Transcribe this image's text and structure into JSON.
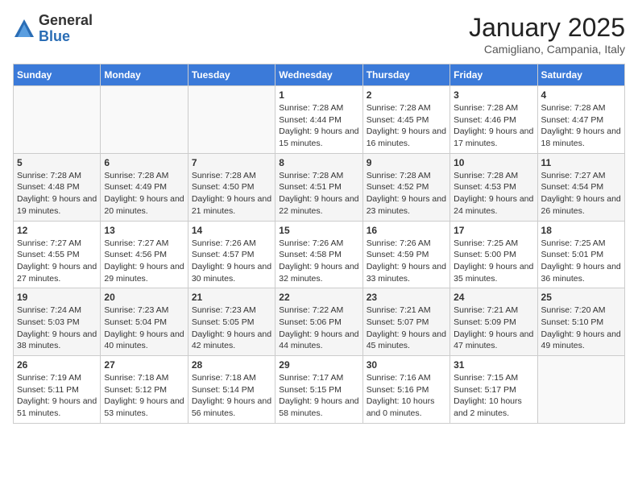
{
  "header": {
    "logo_general": "General",
    "logo_blue": "Blue",
    "month_title": "January 2025",
    "location": "Camigliano, Campania, Italy"
  },
  "days_of_week": [
    "Sunday",
    "Monday",
    "Tuesday",
    "Wednesday",
    "Thursday",
    "Friday",
    "Saturday"
  ],
  "weeks": [
    [
      {
        "day": "",
        "sunrise": "",
        "sunset": "",
        "daylight": ""
      },
      {
        "day": "",
        "sunrise": "",
        "sunset": "",
        "daylight": ""
      },
      {
        "day": "",
        "sunrise": "",
        "sunset": "",
        "daylight": ""
      },
      {
        "day": "1",
        "sunrise": "Sunrise: 7:28 AM",
        "sunset": "Sunset: 4:44 PM",
        "daylight": "Daylight: 9 hours and 15 minutes."
      },
      {
        "day": "2",
        "sunrise": "Sunrise: 7:28 AM",
        "sunset": "Sunset: 4:45 PM",
        "daylight": "Daylight: 9 hours and 16 minutes."
      },
      {
        "day": "3",
        "sunrise": "Sunrise: 7:28 AM",
        "sunset": "Sunset: 4:46 PM",
        "daylight": "Daylight: 9 hours and 17 minutes."
      },
      {
        "day": "4",
        "sunrise": "Sunrise: 7:28 AM",
        "sunset": "Sunset: 4:47 PM",
        "daylight": "Daylight: 9 hours and 18 minutes."
      }
    ],
    [
      {
        "day": "5",
        "sunrise": "Sunrise: 7:28 AM",
        "sunset": "Sunset: 4:48 PM",
        "daylight": "Daylight: 9 hours and 19 minutes."
      },
      {
        "day": "6",
        "sunrise": "Sunrise: 7:28 AM",
        "sunset": "Sunset: 4:49 PM",
        "daylight": "Daylight: 9 hours and 20 minutes."
      },
      {
        "day": "7",
        "sunrise": "Sunrise: 7:28 AM",
        "sunset": "Sunset: 4:50 PM",
        "daylight": "Daylight: 9 hours and 21 minutes."
      },
      {
        "day": "8",
        "sunrise": "Sunrise: 7:28 AM",
        "sunset": "Sunset: 4:51 PM",
        "daylight": "Daylight: 9 hours and 22 minutes."
      },
      {
        "day": "9",
        "sunrise": "Sunrise: 7:28 AM",
        "sunset": "Sunset: 4:52 PM",
        "daylight": "Daylight: 9 hours and 23 minutes."
      },
      {
        "day": "10",
        "sunrise": "Sunrise: 7:28 AM",
        "sunset": "Sunset: 4:53 PM",
        "daylight": "Daylight: 9 hours and 24 minutes."
      },
      {
        "day": "11",
        "sunrise": "Sunrise: 7:27 AM",
        "sunset": "Sunset: 4:54 PM",
        "daylight": "Daylight: 9 hours and 26 minutes."
      }
    ],
    [
      {
        "day": "12",
        "sunrise": "Sunrise: 7:27 AM",
        "sunset": "Sunset: 4:55 PM",
        "daylight": "Daylight: 9 hours and 27 minutes."
      },
      {
        "day": "13",
        "sunrise": "Sunrise: 7:27 AM",
        "sunset": "Sunset: 4:56 PM",
        "daylight": "Daylight: 9 hours and 29 minutes."
      },
      {
        "day": "14",
        "sunrise": "Sunrise: 7:26 AM",
        "sunset": "Sunset: 4:57 PM",
        "daylight": "Daylight: 9 hours and 30 minutes."
      },
      {
        "day": "15",
        "sunrise": "Sunrise: 7:26 AM",
        "sunset": "Sunset: 4:58 PM",
        "daylight": "Daylight: 9 hours and 32 minutes."
      },
      {
        "day": "16",
        "sunrise": "Sunrise: 7:26 AM",
        "sunset": "Sunset: 4:59 PM",
        "daylight": "Daylight: 9 hours and 33 minutes."
      },
      {
        "day": "17",
        "sunrise": "Sunrise: 7:25 AM",
        "sunset": "Sunset: 5:00 PM",
        "daylight": "Daylight: 9 hours and 35 minutes."
      },
      {
        "day": "18",
        "sunrise": "Sunrise: 7:25 AM",
        "sunset": "Sunset: 5:01 PM",
        "daylight": "Daylight: 9 hours and 36 minutes."
      }
    ],
    [
      {
        "day": "19",
        "sunrise": "Sunrise: 7:24 AM",
        "sunset": "Sunset: 5:03 PM",
        "daylight": "Daylight: 9 hours and 38 minutes."
      },
      {
        "day": "20",
        "sunrise": "Sunrise: 7:23 AM",
        "sunset": "Sunset: 5:04 PM",
        "daylight": "Daylight: 9 hours and 40 minutes."
      },
      {
        "day": "21",
        "sunrise": "Sunrise: 7:23 AM",
        "sunset": "Sunset: 5:05 PM",
        "daylight": "Daylight: 9 hours and 42 minutes."
      },
      {
        "day": "22",
        "sunrise": "Sunrise: 7:22 AM",
        "sunset": "Sunset: 5:06 PM",
        "daylight": "Daylight: 9 hours and 44 minutes."
      },
      {
        "day": "23",
        "sunrise": "Sunrise: 7:21 AM",
        "sunset": "Sunset: 5:07 PM",
        "daylight": "Daylight: 9 hours and 45 minutes."
      },
      {
        "day": "24",
        "sunrise": "Sunrise: 7:21 AM",
        "sunset": "Sunset: 5:09 PM",
        "daylight": "Daylight: 9 hours and 47 minutes."
      },
      {
        "day": "25",
        "sunrise": "Sunrise: 7:20 AM",
        "sunset": "Sunset: 5:10 PM",
        "daylight": "Daylight: 9 hours and 49 minutes."
      }
    ],
    [
      {
        "day": "26",
        "sunrise": "Sunrise: 7:19 AM",
        "sunset": "Sunset: 5:11 PM",
        "daylight": "Daylight: 9 hours and 51 minutes."
      },
      {
        "day": "27",
        "sunrise": "Sunrise: 7:18 AM",
        "sunset": "Sunset: 5:12 PM",
        "daylight": "Daylight: 9 hours and 53 minutes."
      },
      {
        "day": "28",
        "sunrise": "Sunrise: 7:18 AM",
        "sunset": "Sunset: 5:14 PM",
        "daylight": "Daylight: 9 hours and 56 minutes."
      },
      {
        "day": "29",
        "sunrise": "Sunrise: 7:17 AM",
        "sunset": "Sunset: 5:15 PM",
        "daylight": "Daylight: 9 hours and 58 minutes."
      },
      {
        "day": "30",
        "sunrise": "Sunrise: 7:16 AM",
        "sunset": "Sunset: 5:16 PM",
        "daylight": "Daylight: 10 hours and 0 minutes."
      },
      {
        "day": "31",
        "sunrise": "Sunrise: 7:15 AM",
        "sunset": "Sunset: 5:17 PM",
        "daylight": "Daylight: 10 hours and 2 minutes."
      },
      {
        "day": "",
        "sunrise": "",
        "sunset": "",
        "daylight": ""
      }
    ]
  ]
}
